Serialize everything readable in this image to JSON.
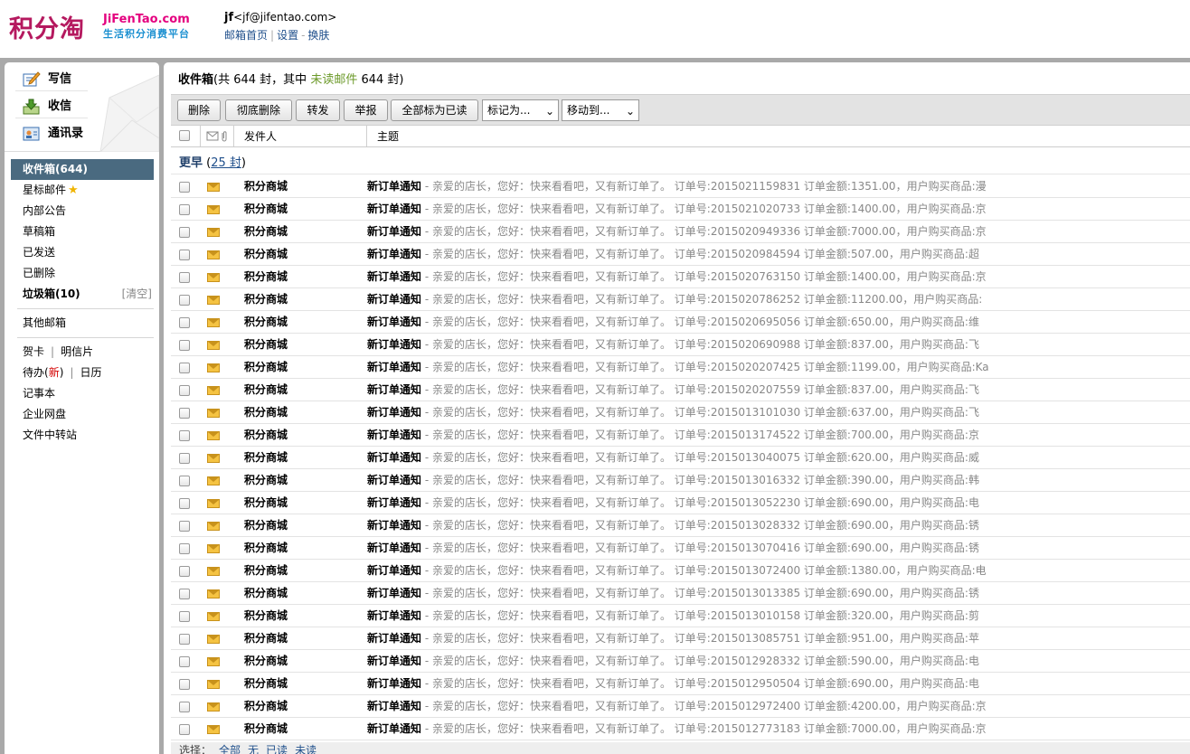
{
  "header": {
    "logo_main": "积分淘",
    "logo_en": "JiFenTao.com",
    "logo_sub": "生活积分消费平台",
    "user_name": "jf",
    "user_email": "<jf@jifentao.com>",
    "links": [
      "邮箱首页",
      "设置",
      "换肤"
    ]
  },
  "sidebar": {
    "quick": {
      "write": "写信",
      "receive": "收信",
      "contacts": "通讯录"
    },
    "folders": {
      "inbox": "收件箱(644)",
      "starred": "星标邮件",
      "notice": "内部公告",
      "drafts": "草稿箱",
      "sent": "已发送",
      "deleted": "已删除",
      "spam": "垃圾箱(10)",
      "spam_clear": "[清空]",
      "other": "其他邮箱",
      "card": "贺卡",
      "postcard": "明信片",
      "todo": "待办",
      "todo_new": "新",
      "calendar": "日历",
      "notes": "记事本",
      "disk": "企业网盘",
      "transfer": "文件中转站"
    }
  },
  "main": {
    "title": "收件箱",
    "summary_pre": "(共 644 封，其中 ",
    "unread_label": "未读邮件",
    "summary_post": " 644 封)",
    "toolbar": {
      "delete": "删除",
      "delete_forever": "彻底删除",
      "forward": "转发",
      "report": "举报",
      "mark_all_read": "全部标为已读",
      "mark_as": "标记为...",
      "move_to": "移动到..."
    },
    "columns": {
      "sender": "发件人",
      "subject": "主题"
    },
    "group": {
      "label": "更早",
      "count": "25 封"
    },
    "select_bar": {
      "label": "选择：",
      "all": "全部",
      "none": "无",
      "read": "已读",
      "unread": "未读"
    }
  },
  "emails": [
    {
      "sender": "积分商城",
      "subject": "新订单通知",
      "summary": " - 亲爱的店长，您好：快来看看吧，又有新订单了。 订单号:2015021159831 订单金额:1351.00，用户购买商品:漫"
    },
    {
      "sender": "积分商城",
      "subject": "新订单通知",
      "summary": " - 亲爱的店长，您好：快来看看吧，又有新订单了。 订单号:2015021020733 订单金额:1400.00，用户购买商品:京"
    },
    {
      "sender": "积分商城",
      "subject": "新订单通知",
      "summary": " - 亲爱的店长，您好：快来看看吧，又有新订单了。 订单号:2015020949336 订单金额:7000.00，用户购买商品:京"
    },
    {
      "sender": "积分商城",
      "subject": "新订单通知",
      "summary": " - 亲爱的店长，您好：快来看看吧，又有新订单了。 订单号:2015020984594 订单金额:507.00，用户购买商品:超"
    },
    {
      "sender": "积分商城",
      "subject": "新订单通知",
      "summary": " - 亲爱的店长，您好：快来看看吧，又有新订单了。 订单号:2015020763150 订单金额:1400.00，用户购买商品:京"
    },
    {
      "sender": "积分商城",
      "subject": "新订单通知",
      "summary": " - 亲爱的店长，您好：快来看看吧，又有新订单了。 订单号:2015020786252 订单金额:11200.00，用户购买商品:"
    },
    {
      "sender": "积分商城",
      "subject": "新订单通知",
      "summary": " - 亲爱的店长，您好：快来看看吧，又有新订单了。 订单号:2015020695056 订单金额:650.00，用户购买商品:维"
    },
    {
      "sender": "积分商城",
      "subject": "新订单通知",
      "summary": " - 亲爱的店长，您好：快来看看吧，又有新订单了。 订单号:2015020690988 订单金额:837.00，用户购买商品:飞"
    },
    {
      "sender": "积分商城",
      "subject": "新订单通知",
      "summary": " - 亲爱的店长，您好：快来看看吧，又有新订单了。 订单号:2015020207425 订单金额:1199.00，用户购买商品:Ka"
    },
    {
      "sender": "积分商城",
      "subject": "新订单通知",
      "summary": " - 亲爱的店长，您好：快来看看吧，又有新订单了。 订单号:2015020207559 订单金额:837.00，用户购买商品:飞"
    },
    {
      "sender": "积分商城",
      "subject": "新订单通知",
      "summary": " - 亲爱的店长，您好：快来看看吧，又有新订单了。 订单号:2015013101030 订单金额:637.00，用户购买商品:飞"
    },
    {
      "sender": "积分商城",
      "subject": "新订单通知",
      "summary": " - 亲爱的店长，您好：快来看看吧，又有新订单了。 订单号:2015013174522 订单金额:700.00，用户购买商品:京"
    },
    {
      "sender": "积分商城",
      "subject": "新订单通知",
      "summary": " - 亲爱的店长，您好：快来看看吧，又有新订单了。 订单号:2015013040075 订单金额:620.00，用户购买商品:威"
    },
    {
      "sender": "积分商城",
      "subject": "新订单通知",
      "summary": " - 亲爱的店长，您好：快来看看吧，又有新订单了。 订单号:2015013016332 订单金额:390.00，用户购买商品:韩"
    },
    {
      "sender": "积分商城",
      "subject": "新订单通知",
      "summary": " - 亲爱的店长，您好：快来看看吧，又有新订单了。 订单号:2015013052230 订单金额:690.00，用户购买商品:电"
    },
    {
      "sender": "积分商城",
      "subject": "新订单通知",
      "summary": " - 亲爱的店长，您好：快来看看吧，又有新订单了。 订单号:2015013028332 订单金额:690.00，用户购买商品:锈"
    },
    {
      "sender": "积分商城",
      "subject": "新订单通知",
      "summary": " - 亲爱的店长，您好：快来看看吧，又有新订单了。 订单号:2015013070416 订单金额:690.00，用户购买商品:锈"
    },
    {
      "sender": "积分商城",
      "subject": "新订单通知",
      "summary": " - 亲爱的店长，您好：快来看看吧，又有新订单了。 订单号:2015013072400 订单金额:1380.00，用户购买商品:电"
    },
    {
      "sender": "积分商城",
      "subject": "新订单通知",
      "summary": " - 亲爱的店长，您好：快来看看吧，又有新订单了。 订单号:2015013013385 订单金额:690.00，用户购买商品:锈"
    },
    {
      "sender": "积分商城",
      "subject": "新订单通知",
      "summary": " - 亲爱的店长，您好：快来看看吧，又有新订单了。 订单号:2015013010158 订单金额:320.00，用户购买商品:剪"
    },
    {
      "sender": "积分商城",
      "subject": "新订单通知",
      "summary": " - 亲爱的店长，您好：快来看看吧，又有新订单了。 订单号:2015013085751 订单金额:951.00，用户购买商品:苹"
    },
    {
      "sender": "积分商城",
      "subject": "新订单通知",
      "summary": " - 亲爱的店长，您好：快来看看吧，又有新订单了。 订单号:2015012928332 订单金额:590.00，用户购买商品:电"
    },
    {
      "sender": "积分商城",
      "subject": "新订单通知",
      "summary": " - 亲爱的店长，您好：快来看看吧，又有新订单了。 订单号:2015012950504 订单金额:690.00，用户购买商品:电"
    },
    {
      "sender": "积分商城",
      "subject": "新订单通知",
      "summary": " - 亲爱的店长，您好：快来看看吧，又有新订单了。 订单号:2015012972400 订单金额:4200.00，用户购买商品:京"
    },
    {
      "sender": "积分商城",
      "subject": "新订单通知",
      "summary": " - 亲爱的店长，您好：快来看看吧，又有新订单了。 订单号:2015012773183 订单金额:7000.00，用户购买商品:京"
    }
  ],
  "colors": {
    "brand": "#b5195f",
    "accent": "#1a8fd0",
    "active_folder": "#4a6a80",
    "unread": "#6c9a2a"
  }
}
